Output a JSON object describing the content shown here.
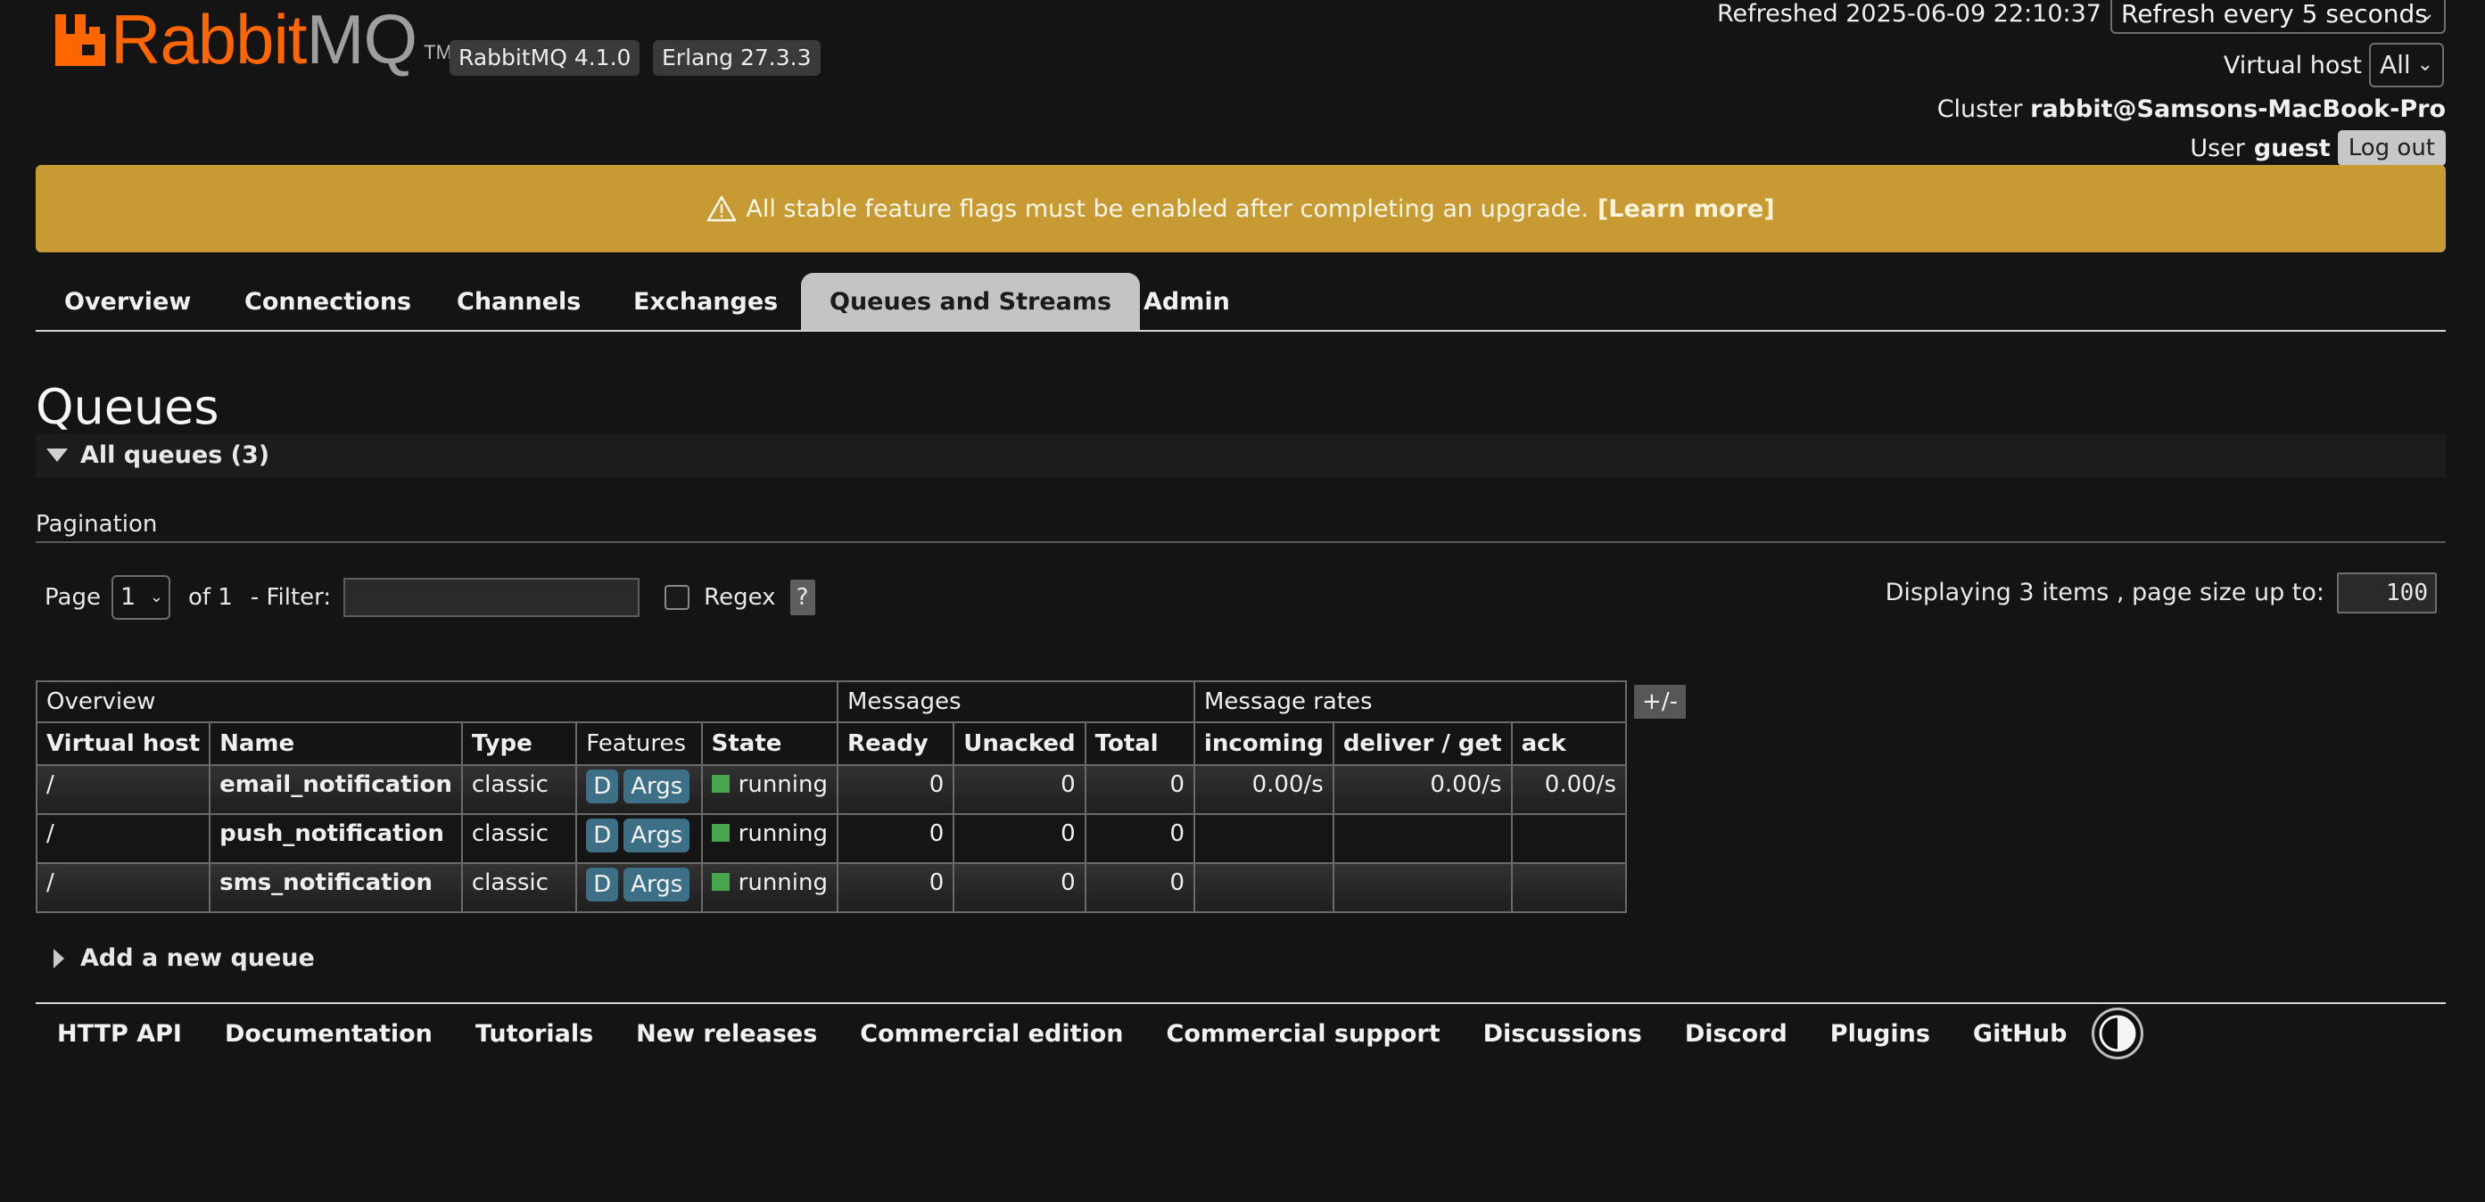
{
  "header": {
    "logo_brand": "Rabbit",
    "logo_suffix": "MQ",
    "logo_tm": "TM",
    "rabbitmq_version": "RabbitMQ 4.1.0",
    "erlang_version": "Erlang 27.3.3",
    "refreshed": "Refreshed 2025-06-09 22:10:37",
    "refresh_select": "Refresh every 5 seconds",
    "vhost_label": "Virtual host",
    "vhost_value": "All",
    "cluster_label": "Cluster",
    "cluster_name": "rabbit@Samsons-MacBook-Pro",
    "user_label": "User",
    "user_name": "guest",
    "logout_label": "Log out"
  },
  "banner": {
    "icon": "warning-icon",
    "message": "All stable feature flags must be enabled after completing an upgrade.",
    "link": "[Learn more]",
    "color": "#c79a34"
  },
  "tabs": [
    {
      "label": "Overview"
    },
    {
      "label": "Connections"
    },
    {
      "label": "Channels"
    },
    {
      "label": "Exchanges"
    },
    {
      "label": "Queues and Streams",
      "active": true
    },
    {
      "label": "Admin"
    }
  ],
  "main": {
    "title": "Queues",
    "section_label": "All queues (3)",
    "pagination_label": "Pagination",
    "page_label": "Page",
    "page_value": "1",
    "of_label": "of 1",
    "filter_label": "- Filter:",
    "filter_value": "",
    "regex_label": "Regex",
    "regex_help": "?",
    "displaying": "Displaying 3 items , page size up to:",
    "page_size": "100",
    "columns_toggle": "+/-",
    "add_queue_label": "Add a new queue"
  },
  "table": {
    "groups": [
      "Overview",
      "Messages",
      "Message rates"
    ],
    "headers": [
      "Virtual host",
      "Name",
      "Type",
      "Features",
      "State",
      "Ready",
      "Unacked",
      "Total",
      "incoming",
      "deliver / get",
      "ack"
    ],
    "rows": [
      {
        "vhost": "/",
        "name": "email_notification",
        "type": "classic",
        "features": [
          "D",
          "Args"
        ],
        "state": "running",
        "ready": "0",
        "unacked": "0",
        "total": "0",
        "incoming": "0.00/s",
        "deliver_get": "0.00/s",
        "ack": "0.00/s"
      },
      {
        "vhost": "/",
        "name": "push_notification",
        "type": "classic",
        "features": [
          "D",
          "Args"
        ],
        "state": "running",
        "ready": "0",
        "unacked": "0",
        "total": "0",
        "incoming": "",
        "deliver_get": "",
        "ack": ""
      },
      {
        "vhost": "/",
        "name": "sms_notification",
        "type": "classic",
        "features": [
          "D",
          "Args"
        ],
        "state": "running",
        "ready": "0",
        "unacked": "0",
        "total": "0",
        "incoming": "",
        "deliver_get": "",
        "ack": ""
      }
    ]
  },
  "footer": {
    "links": [
      "HTTP API",
      "Documentation",
      "Tutorials",
      "New releases",
      "Commercial edition",
      "Commercial support",
      "Discussions",
      "Discord",
      "Plugins",
      "GitHub"
    ],
    "theme_icon": "contrast-toggle-icon"
  },
  "colors": {
    "brand_orange": "#ff6600",
    "running_green": "#46a54d",
    "feature_badge": "#3d6f86",
    "background": "#141414"
  }
}
